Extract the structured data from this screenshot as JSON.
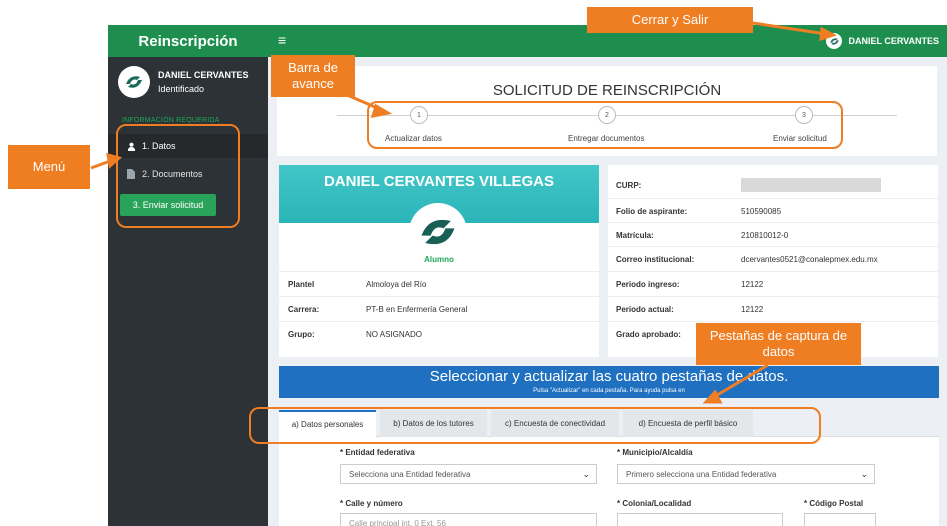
{
  "sidebar": {
    "brand": "Reinscripción",
    "user_name": "DANIEL CERVANTES",
    "user_status": "Identificado",
    "section_label": "INFORMACIÓN REQUERIDA",
    "items": [
      {
        "label": "1. Datos",
        "icon": "user-icon"
      },
      {
        "label": "2. Documentos",
        "icon": "document-icon"
      }
    ],
    "submit_label": "3. Enviar solicitud"
  },
  "topbar": {
    "menu_icon": "hamburger-icon",
    "user_name": "DANIEL CERVANTES"
  },
  "progress": {
    "title": "SOLICITUD DE REINSCRIPCIÓN",
    "steps": [
      {
        "number": "1",
        "label": "Actualizar datos"
      },
      {
        "number": "2",
        "label": "Entregar documentos"
      },
      {
        "number": "3",
        "label": "Enviar solicitud"
      }
    ]
  },
  "profile": {
    "full_name": "DANIEL CERVANTES VILLEGAS",
    "role": "Alumno",
    "rows": [
      {
        "key": "Plantel",
        "value": "Almoloya del Río"
      },
      {
        "key": "Carrera:",
        "value": "PT-B en Enfermería General"
      },
      {
        "key": "Grupo:",
        "value": "NO ASIGNADO"
      }
    ]
  },
  "info": {
    "rows": [
      {
        "key": "CURP:",
        "value": ""
      },
      {
        "key": "Folio de aspirante:",
        "value": "510590085"
      },
      {
        "key": "Matrícula:",
        "value": "210810012-0"
      },
      {
        "key": "Correo institucional:",
        "value": "dcervantes0521@conalepmex.edu.mx"
      },
      {
        "key": "Periodo ingreso:",
        "value": "12122"
      },
      {
        "key": "Periodo actual:",
        "value": "12122"
      },
      {
        "key": "Grado aprobado:",
        "value": ""
      }
    ]
  },
  "banner": {
    "headline": "Seleccionar y actualizar las cuatro pestañas de datos.",
    "subline": "Pulsa \"Actualizar\" en cada pestaña. Para ayuda pulsa en"
  },
  "tabs": [
    {
      "label": "a) Datos personales"
    },
    {
      "label": "b) Datos de los tutores"
    },
    {
      "label": "c) Encuesta de conectividad"
    },
    {
      "label": "d) Encuesta de perfil básico"
    }
  ],
  "form": {
    "entidad_label": "* Entidad federativa",
    "entidad_value": "Selecciona una Entidad federativa",
    "municipio_label": "* Municipio/Alcaldía",
    "municipio_value": "Primero selecciona una Entidad federativa",
    "calle_label": "* Calle y número",
    "calle_value": "Calle principal int. 0 Ext. 56",
    "colonia_label": "* Colonia/Localidad",
    "cp_label": "* Código Postal"
  },
  "annotations": {
    "cerrar": "Cerrar y Salir",
    "barra": "Barra de avance",
    "menu": "Menú",
    "pestanas": "Pestañas de captura de datos"
  },
  "colors": {
    "brand_green": "#1e8e4e",
    "sidebar_dark": "#2d3236",
    "banner_blue": "#1f70c1",
    "annotation_orange": "#ef7d22"
  }
}
